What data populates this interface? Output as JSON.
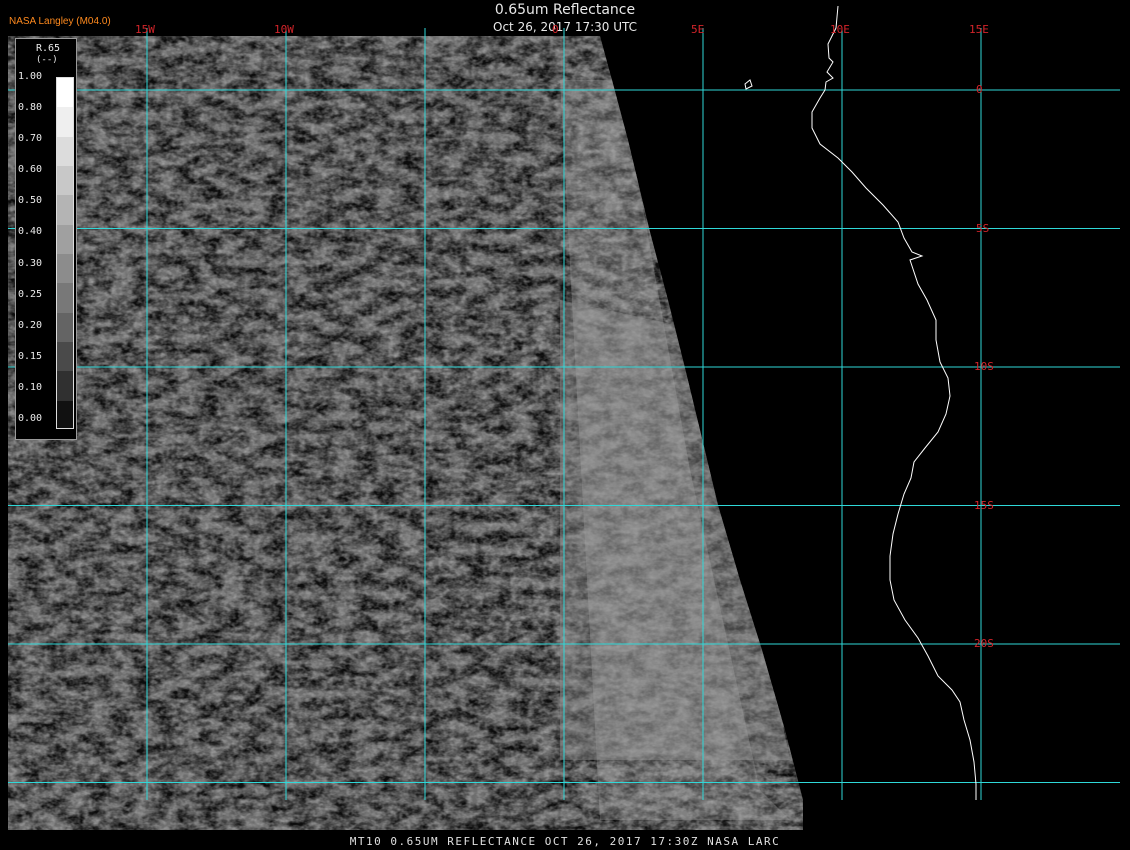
{
  "header": {
    "title": "0.65um Reflectance",
    "datetime": "Oct 26, 2017 17:30 UTC",
    "brand": "NASA Langley (M04.0)"
  },
  "footer": {
    "caption": "MT10  0.65UM REFLECTANCE   OCT 26, 2017 17:30Z   NASA LARC"
  },
  "legend": {
    "variable": "R.65",
    "units": "(--)",
    "ticks": [
      "1.00",
      "0.80",
      "0.70",
      "0.60",
      "0.50",
      "0.40",
      "0.30",
      "0.25",
      "0.20",
      "0.15",
      "0.10",
      "0.00"
    ],
    "shades": [
      "#ffffff",
      "#efefef",
      "#dcdcdc",
      "#c8c8c8",
      "#b4b4b4",
      "#a0a0a0",
      "#8c8c8c",
      "#787878",
      "#646464",
      "#4a4a4a",
      "#303030",
      "#111111"
    ]
  },
  "map": {
    "grid_color": "#2fd8d8",
    "label_color": "#d4242a",
    "coast_color": "#ffffff",
    "longitudes": [
      {
        "value": -15,
        "label": "15W"
      },
      {
        "value": -10,
        "label": "10W"
      },
      {
        "value": -5,
        "label": ""
      },
      {
        "value": 0,
        "label": "0"
      },
      {
        "value": 5,
        "label": "5E"
      },
      {
        "value": 10,
        "label": "10E"
      },
      {
        "value": 15,
        "label": "15E"
      }
    ],
    "latitudes": [
      {
        "value": 0,
        "label": "0"
      },
      {
        "value": -5,
        "label": "5S"
      },
      {
        "value": -10,
        "label": "10S"
      },
      {
        "value": -15,
        "label": "15S"
      },
      {
        "value": -20,
        "label": "20S"
      },
      {
        "value": -25,
        "label": ""
      }
    ]
  }
}
